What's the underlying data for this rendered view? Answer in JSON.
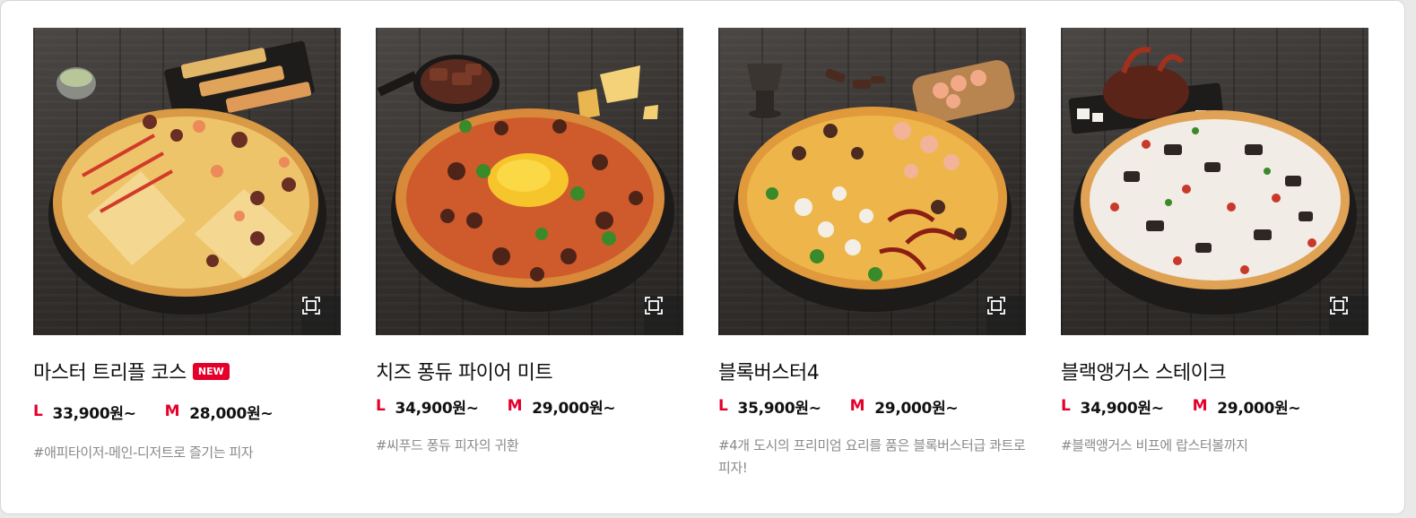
{
  "products": [
    {
      "name": "마스터 트리플 코스",
      "badge": "NEW",
      "prices": [
        {
          "size": "L",
          "price": "33,900원~"
        },
        {
          "size": "M",
          "price": "28,000원~"
        }
      ],
      "desc": "#애피타이저-메인-디저트로 즐기는 피자"
    },
    {
      "name": "치즈 퐁듀 파이어 미트",
      "badge": "",
      "prices": [
        {
          "size": "L",
          "price": "34,900원~"
        },
        {
          "size": "M",
          "price": "29,000원~"
        }
      ],
      "desc": "#씨푸드 퐁듀 피자의 귀환"
    },
    {
      "name": "블록버스터4",
      "badge": "",
      "prices": [
        {
          "size": "L",
          "price": "35,900원~"
        },
        {
          "size": "M",
          "price": "29,000원~"
        }
      ],
      "desc": "#4개 도시의 프리미엄 요리를 품은 블록버스터급 콰트로 피자!"
    },
    {
      "name": "블랙앵거스 스테이크",
      "badge": "",
      "prices": [
        {
          "size": "L",
          "price": "34,900원~"
        },
        {
          "size": "M",
          "price": "29,000원~"
        }
      ],
      "desc": "#블랙앵거스 비프에 랍스터볼까지"
    }
  ],
  "icons": {
    "zoom": "expand-icon"
  },
  "colors": {
    "accent": "#e4002b",
    "title": "#111111",
    "desc": "#8a8a8a"
  }
}
